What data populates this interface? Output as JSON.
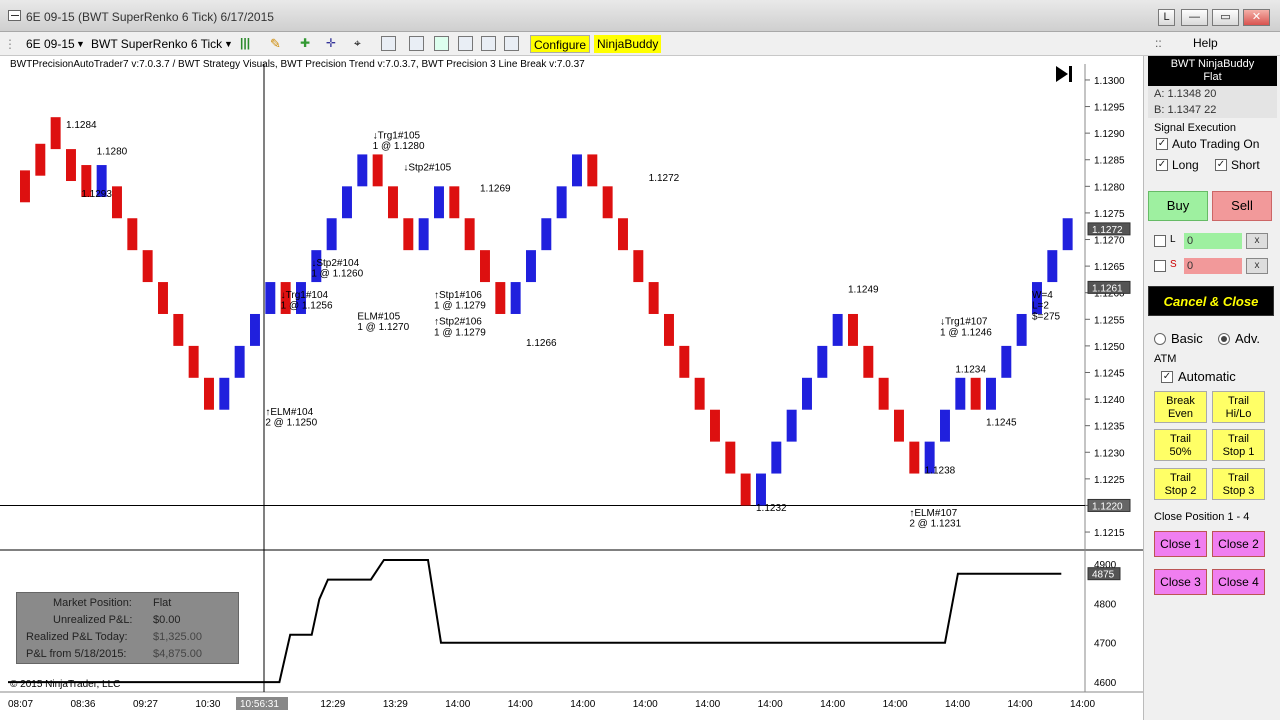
{
  "window": {
    "title": "6E 09-15 (BWT SuperRenko  6 Tick)  6/17/2015",
    "buttons": [
      "L",
      "—",
      "▭",
      "✕"
    ]
  },
  "toolbar": {
    "instrument": "6E 09-15",
    "bar_type": "BWT SuperRenko  6 Tick",
    "configure_label": "Configure",
    "ninjabuddy_label": "NinjaBuddy"
  },
  "help_bar": {
    "dots": "::",
    "help_label": "Help"
  },
  "strategy_line": "BWTPrecisionAutoTrader7 v:7.0.3.7 / BWT Strategy Visuals, BWT Precision Trend v:7.0.3.7, BWT Precision 3 Line Break v:7.0.37",
  "copyright": "© 2015 NinjaTrader, LLC",
  "colors": {
    "up_bar": "#2020dd",
    "down_bar": "#dd1010",
    "buy": "#9ef0a0",
    "sell": "#f2999a",
    "highlight": "#ffff00"
  },
  "price_axis": {
    "labels": [
      "1.1300",
      "1.1295",
      "1.1290",
      "1.1285",
      "1.1280",
      "1.1275",
      "1.1270",
      "1.1265",
      "1.1260",
      "1.1255",
      "1.1250",
      "1.1245",
      "1.1240",
      "1.1235",
      "1.1230",
      "1.1225",
      "1.1220",
      "1.1215"
    ],
    "last_price_tag": "1.1272",
    "mid_tag": "1.1261",
    "cursor_tag": "1.1220"
  },
  "pnl_axis": {
    "labels": [
      "4900",
      "4800",
      "4700",
      "4600"
    ],
    "current_tag": "4875"
  },
  "time_axis": [
    "08:07",
    "08:36",
    "09:27",
    "10:30",
    "11:09",
    "12:29",
    "13:29",
    "14:00",
    "14:00",
    "14:00",
    "14:00",
    "14:00",
    "14:00",
    "14:00",
    "14:00",
    "14:00",
    "14:00",
    "14:00"
  ],
  "time_cursor_label": "10:56:31",
  "chart_data": {
    "type": "bar",
    "title": "",
    "price_ylim": [
      1.1212,
      1.1303
    ],
    "bars": [
      [
        1.1283,
        1.1277
      ],
      [
        1.1288,
        1.1282
      ],
      [
        1.1293,
        1.1287
      ],
      [
        1.1287,
        1.1281
      ],
      [
        1.1284,
        1.1278
      ],
      [
        1.1278,
        1.1284
      ],
      [
        1.128,
        1.1274
      ],
      [
        1.1274,
        1.1268
      ],
      [
        1.1268,
        1.1262
      ],
      [
        1.1262,
        1.1256
      ],
      [
        1.1256,
        1.125
      ],
      [
        1.125,
        1.1244
      ],
      [
        1.1244,
        1.1238
      ],
      [
        1.1238,
        1.1244
      ],
      [
        1.1244,
        1.125
      ],
      [
        1.125,
        1.1256
      ],
      [
        1.1256,
        1.1262
      ],
      [
        1.1262,
        1.1256
      ],
      [
        1.1256,
        1.1262
      ],
      [
        1.1262,
        1.1268
      ],
      [
        1.1268,
        1.1274
      ],
      [
        1.1274,
        1.128
      ],
      [
        1.128,
        1.1286
      ],
      [
        1.1286,
        1.128
      ],
      [
        1.128,
        1.1274
      ],
      [
        1.1274,
        1.1268
      ],
      [
        1.1268,
        1.1274
      ],
      [
        1.1274,
        1.128
      ],
      [
        1.128,
        1.1274
      ],
      [
        1.1274,
        1.1268
      ],
      [
        1.1268,
        1.1262
      ],
      [
        1.1262,
        1.1256
      ],
      [
        1.1256,
        1.1262
      ],
      [
        1.1262,
        1.1268
      ],
      [
        1.1268,
        1.1274
      ],
      [
        1.1274,
        1.128
      ],
      [
        1.128,
        1.1286
      ],
      [
        1.1286,
        1.128
      ],
      [
        1.128,
        1.1274
      ],
      [
        1.1274,
        1.1268
      ],
      [
        1.1268,
        1.1262
      ],
      [
        1.1262,
        1.1256
      ],
      [
        1.1256,
        1.125
      ],
      [
        1.125,
        1.1244
      ],
      [
        1.1244,
        1.1238
      ],
      [
        1.1238,
        1.1232
      ],
      [
        1.1232,
        1.1226
      ],
      [
        1.1226,
        1.122
      ],
      [
        1.122,
        1.1226
      ],
      [
        1.1226,
        1.1232
      ],
      [
        1.1232,
        1.1238
      ],
      [
        1.1238,
        1.1244
      ],
      [
        1.1244,
        1.125
      ],
      [
        1.125,
        1.1256
      ],
      [
        1.1256,
        1.125
      ],
      [
        1.125,
        1.1244
      ],
      [
        1.1244,
        1.1238
      ],
      [
        1.1238,
        1.1232
      ],
      [
        1.1232,
        1.1226
      ],
      [
        1.1226,
        1.1232
      ],
      [
        1.1232,
        1.1238
      ],
      [
        1.1238,
        1.1244
      ],
      [
        1.1244,
        1.1238
      ],
      [
        1.1238,
        1.1244
      ],
      [
        1.1244,
        1.125
      ],
      [
        1.125,
        1.1256
      ],
      [
        1.1256,
        1.1262
      ],
      [
        1.1262,
        1.1268
      ],
      [
        1.1268,
        1.1274
      ]
    ],
    "signals": [
      {
        "kind": "label",
        "text": "1.1284",
        "price": 1.1291,
        "bar": 3
      },
      {
        "kind": "label",
        "text": "1.1280",
        "price": 1.1286,
        "bar": 5
      },
      {
        "kind": "label",
        "text": "1.1293",
        "price": 1.1278,
        "bar": 4
      },
      {
        "kind": "label",
        "text": "↓Trg1#105",
        "price": 1.1289,
        "bar": 23
      },
      {
        "kind": "label",
        "text": "1 @ 1.1280",
        "price": 1.1287,
        "bar": 23
      },
      {
        "kind": "label",
        "text": "↓Stp2#105",
        "price": 1.1283,
        "bar": 25
      },
      {
        "kind": "label",
        "text": "1.1269",
        "price": 1.1279,
        "bar": 30
      },
      {
        "kind": "label",
        "text": "↓Stp2#104",
        "price": 1.1265,
        "bar": 19
      },
      {
        "kind": "label",
        "text": "1 @ 1.1260",
        "price": 1.1263,
        "bar": 19
      },
      {
        "kind": "label",
        "text": "↓Trg1#104",
        "price": 1.1259,
        "bar": 17
      },
      {
        "kind": "label",
        "text": "1 @ 1.1256",
        "price": 1.1257,
        "bar": 17
      },
      {
        "kind": "label",
        "text": "↑Stp1#106",
        "price": 1.1259,
        "bar": 27
      },
      {
        "kind": "label",
        "text": "1 @ 1.1279",
        "price": 1.1257,
        "bar": 27
      },
      {
        "kind": "label",
        "text": "↑Stp2#106",
        "price": 1.1254,
        "bar": 27
      },
      {
        "kind": "label",
        "text": "1 @ 1.1279",
        "price": 1.1252,
        "bar": 27
      },
      {
        "kind": "label",
        "text": "ELM#105",
        "price": 1.1255,
        "bar": 22
      },
      {
        "kind": "label",
        "text": "1 @ 1.1270",
        "price": 1.1253,
        "bar": 22
      },
      {
        "kind": "label",
        "text": "1.1266",
        "price": 1.125,
        "bar": 33
      },
      {
        "kind": "label",
        "text": "1.1272",
        "price": 1.1281,
        "bar": 41
      },
      {
        "kind": "label",
        "text": "↑ELM#104",
        "price": 1.1237,
        "bar": 16
      },
      {
        "kind": "label",
        "text": "2 @ 1.1250",
        "price": 1.1235,
        "bar": 16
      },
      {
        "kind": "label",
        "text": "1.1232",
        "price": 1.1219,
        "bar": 48
      },
      {
        "kind": "label",
        "text": "1.1249",
        "price": 1.126,
        "bar": 54
      },
      {
        "kind": "label",
        "text": "↓Trg1#107",
        "price": 1.1254,
        "bar": 60
      },
      {
        "kind": "label",
        "text": "1 @ 1.1246",
        "price": 1.1252,
        "bar": 60
      },
      {
        "kind": "label",
        "text": "1.1234",
        "price": 1.1245,
        "bar": 61
      },
      {
        "kind": "label",
        "text": "1.1245",
        "price": 1.1235,
        "bar": 63
      },
      {
        "kind": "label",
        "text": "1.1238",
        "price": 1.1226,
        "bar": 59
      },
      {
        "kind": "label",
        "text": "↑ELM#107",
        "price": 1.1218,
        "bar": 58
      },
      {
        "kind": "label",
        "text": "2 @ 1.1231",
        "price": 1.1216,
        "bar": 58
      },
      {
        "kind": "label",
        "text": "W=4",
        "price": 1.1259,
        "bar": 66
      },
      {
        "kind": "label",
        "text": "L=2",
        "price": 1.1257,
        "bar": 66
      },
      {
        "kind": "label",
        "text": "$=275",
        "price": 1.1255,
        "bar": 66
      }
    ],
    "pnl_series": {
      "name": "",
      "ylim": [
        4580,
        4930
      ],
      "points": [
        [
          0,
          4600
        ],
        [
          0.252,
          4600
        ],
        [
          0.262,
          4720
        ],
        [
          0.282,
          4720
        ],
        [
          0.289,
          4810
        ],
        [
          0.297,
          4860
        ],
        [
          0.337,
          4860
        ],
        [
          0.349,
          4970
        ],
        [
          0.369,
          4970
        ],
        [
          0.375,
          4960
        ],
        [
          0.39,
          4960
        ],
        [
          0.402,
          4700
        ],
        [
          0.87,
          4700
        ],
        [
          0.882,
          4875
        ],
        [
          0.978,
          4875
        ]
      ]
    }
  },
  "panel": {
    "header_line1": "BWT NinjaBuddy",
    "header_line2": "Flat",
    "ask": "A: 1.1348 20",
    "bid": "B: 1.1347 22",
    "signal_execution": "Signal Execution",
    "auto_trading": "Auto Trading On",
    "long": "Long",
    "short": "Short",
    "buy": "Buy",
    "sell": "Sell",
    "l_label": "L",
    "s_label": "S",
    "l_qty": "0",
    "s_qty": "0",
    "x_label": "x",
    "cancel_close": "Cancel & Close",
    "basic": "Basic",
    "adv": "Adv.",
    "atm": "ATM",
    "automatic": "Automatic",
    "break_even_1": "Break",
    "break_even_2": "Even",
    "trail_hilo_1": "Trail",
    "trail_hilo_2": "Hi/Lo",
    "trail_50_1": "Trail",
    "trail_50_2": "50%",
    "trail_stop1_1": "Trail",
    "trail_stop1_2": "Stop 1",
    "trail_stop2_1": "Trail",
    "trail_stop2_2": "Stop 2",
    "trail_stop3_1": "Trail",
    "trail_stop3_2": "Stop 3",
    "close_position": "Close Position 1 - 4",
    "close1": "Close 1",
    "close2": "Close 2",
    "close3": "Close 3",
    "close4": "Close 4"
  },
  "pnl_box": {
    "market_position_label": "Market Position:",
    "market_position_value": "Flat",
    "unrealized_label": "Unrealized P&L:",
    "unrealized_value": "$0.00",
    "realized_label": "Realized P&L Today:",
    "realized_value": "$1,325.00",
    "from_label": "P&L from 5/18/2015:",
    "from_value": "$4,875.00"
  }
}
